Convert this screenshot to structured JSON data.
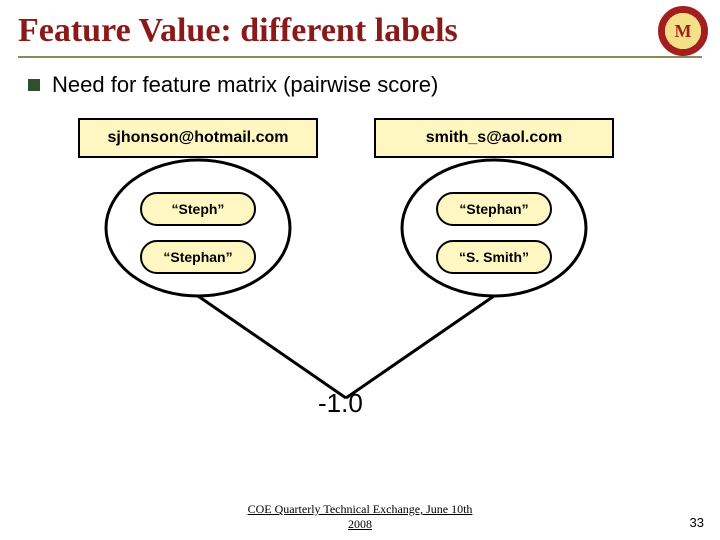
{
  "title": "Feature Value: different labels",
  "bullet": "Need for feature matrix (pairwise score)",
  "left": {
    "header": "sjhonson@hotmail.com",
    "label1": "“Steph”",
    "label2": "“Stephan”"
  },
  "right": {
    "header": "smith_s@aol.com",
    "label1": "“Stephan”",
    "label2": "“S. Smith”"
  },
  "score": "-1.0",
  "footer_line1": "COE Quarterly Technical Exchange, June 10th",
  "footer_line2": "2008",
  "page_number": "33",
  "logo_letter": "M"
}
